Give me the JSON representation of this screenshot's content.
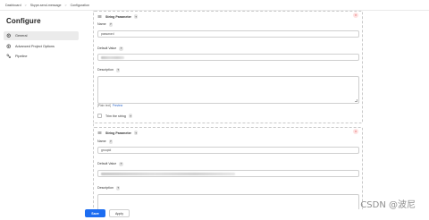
{
  "breadcrumb": [
    "Dashboard",
    "Skype-send-message",
    "Configuration"
  ],
  "sidebar": {
    "title": "Configure",
    "items": [
      {
        "label": "General",
        "icon": "gear-icon",
        "active": true
      },
      {
        "label": "Advanced Project Options",
        "icon": "advanced-options-icon",
        "active": false
      },
      {
        "label": "Pipeline",
        "icon": "pipeline-icon",
        "active": false
      }
    ]
  },
  "params": [
    {
      "header": "String Parameter",
      "help": "?",
      "name_label": "Name",
      "name_value": "password",
      "default_label": "Default Value",
      "description_label": "Description",
      "format_note": "[Plain text]",
      "preview_label": "Preview",
      "trim_label": "Trim the string"
    },
    {
      "header": "String Parameter",
      "help": "?",
      "name_label": "Name",
      "name_value": "groupid",
      "default_label": "Default Value",
      "description_label": "Description"
    }
  ],
  "actions": {
    "save": "Save",
    "apply": "Apply"
  },
  "watermark": "CSDN @波尼",
  "colors": {
    "accent": "#1c6df1",
    "delete": "#d33333",
    "link": "#2a64c8"
  }
}
